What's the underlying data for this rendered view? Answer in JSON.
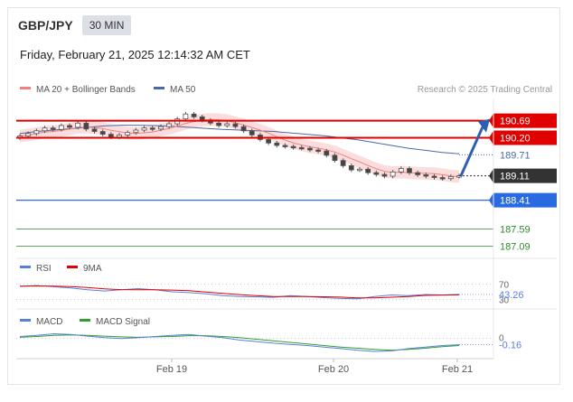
{
  "header": {
    "symbol": "GBP/JPY",
    "timeframe": "30 MIN",
    "datetime": "Friday, February 21, 2025 12:14:32 AM CET"
  },
  "legend": {
    "ma20": "MA 20 + Bollinger Bands",
    "ma50": "MA 50",
    "credit": "Research © 2025 Trading Central"
  },
  "colors": {
    "resistance": "#e00000",
    "support": "#2a6ae0",
    "target": "#2e8b2e",
    "current": "#333333",
    "ma20": "#f08080",
    "ma50": "#4a6aa5",
    "bollinger_fill": "#fbd4d4",
    "rsi": "#5a7fe0",
    "rsi_ma": "#e00000",
    "macd": "#5a7fe0",
    "macd_signal": "#2ea02e"
  },
  "chart_data": [
    {
      "type": "candlestick",
      "x_ticks": [
        "Feb 19",
        "Feb 20",
        "Feb 21"
      ],
      "ylim": [
        186.9,
        191.3
      ],
      "price_close_series": [
        190.25,
        190.32,
        190.4,
        190.48,
        190.44,
        190.55,
        190.5,
        190.62,
        190.45,
        190.38,
        190.3,
        190.22,
        190.28,
        190.35,
        190.42,
        190.48,
        190.45,
        190.52,
        190.6,
        190.74,
        190.88,
        190.8,
        190.7,
        190.62,
        190.55,
        190.6,
        190.52,
        190.4,
        190.28,
        190.15,
        190.05,
        189.98,
        189.95,
        189.92,
        189.9,
        189.85,
        189.82,
        189.7,
        189.55,
        189.4,
        189.28,
        189.3,
        189.2,
        189.15,
        189.1,
        189.22,
        189.32,
        189.2,
        189.14,
        189.1,
        189.06,
        189.03,
        189.09,
        189.11
      ],
      "ma50_series": [
        190.32,
        190.38,
        190.42,
        190.46,
        190.5,
        190.54,
        190.56,
        190.56,
        190.55,
        190.53,
        190.5,
        190.47,
        190.44,
        190.42,
        190.4,
        190.38,
        190.34,
        190.3,
        190.26,
        190.2,
        190.14,
        190.06,
        189.98,
        189.9,
        189.84,
        189.78,
        189.74
      ],
      "levels": [
        {
          "value": 190.69,
          "label": "190.69",
          "role": "resistance"
        },
        {
          "value": 190.2,
          "label": "190.20",
          "role": "resistance"
        },
        {
          "value": 189.71,
          "label": "189.71",
          "role": "ma50"
        },
        {
          "value": 189.11,
          "label": "189.11",
          "role": "current"
        },
        {
          "value": 188.41,
          "label": "188.41",
          "role": "support"
        },
        {
          "value": 187.59,
          "label": "187.59",
          "role": "target"
        },
        {
          "value": 187.09,
          "label": "187.09",
          "role": "target"
        }
      ],
      "projection": "arrow up from 189.11 toward 190.69"
    },
    {
      "type": "line",
      "series": [
        {
          "name": "RSI"
        },
        {
          "name": "9MA"
        }
      ],
      "levels": [
        {
          "value": 70,
          "label": "70"
        },
        {
          "value": 30,
          "label": "30"
        }
      ],
      "current_label": "43.26",
      "rsi_values": [
        64,
        66,
        63,
        60,
        55,
        52,
        55,
        58,
        55,
        50,
        48,
        45,
        40,
        38,
        37,
        36,
        40,
        38,
        35,
        33,
        32,
        38,
        42,
        40,
        43,
        42,
        43.26
      ]
    },
    {
      "type": "line",
      "series": [
        {
          "name": "MACD"
        },
        {
          "name": "MACD Signal"
        }
      ],
      "zero_label": "0",
      "current_label": "-0.16",
      "macd_values": [
        0.05,
        0.08,
        0.12,
        0.1,
        0.06,
        0.02,
        0.0,
        0.02,
        0.05,
        0.08,
        0.1,
        0.06,
        0.02,
        -0.04,
        -0.08,
        -0.12,
        -0.15,
        -0.18,
        -0.22,
        -0.26,
        -0.3,
        -0.33,
        -0.32,
        -0.26,
        -0.22,
        -0.18,
        -0.16
      ],
      "signal_values": [
        0.03,
        0.05,
        0.08,
        0.09,
        0.08,
        0.06,
        0.04,
        0.03,
        0.04,
        0.05,
        0.07,
        0.07,
        0.05,
        0.02,
        -0.02,
        -0.06,
        -0.1,
        -0.14,
        -0.18,
        -0.22,
        -0.25,
        -0.28,
        -0.3,
        -0.28,
        -0.25,
        -0.21,
        -0.18
      ]
    }
  ]
}
